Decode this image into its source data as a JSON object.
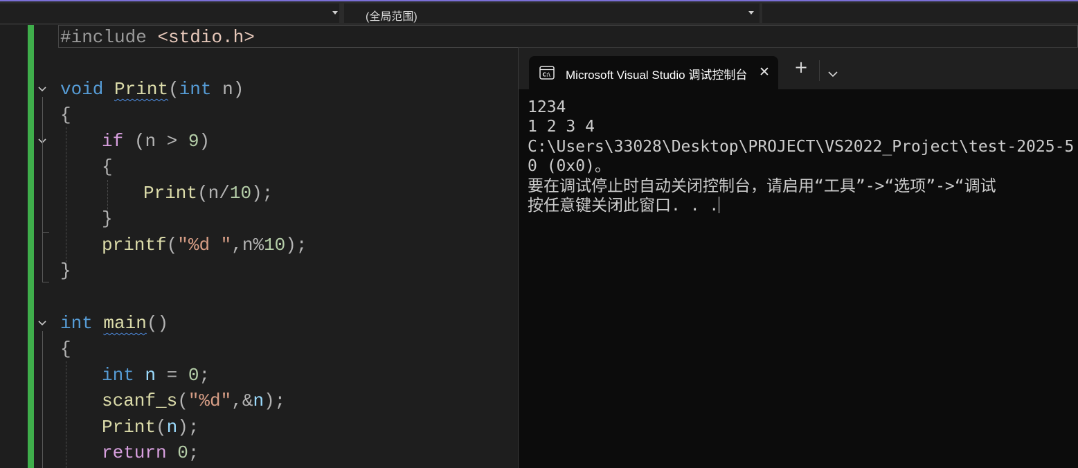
{
  "navbar": {
    "scope_dropdown": "(全局范围)"
  },
  "editor": {
    "include_line": "#include <stdio.h>",
    "tokens": {
      "include": "#include",
      "header": "<stdio.h>",
      "void": "void",
      "int": "int",
      "if": "if",
      "return": "return",
      "print": "Print",
      "printf": "printf",
      "scanf_s": "scanf_s",
      "main": "main",
      "n": "n",
      "nine": "9",
      "ten": "10",
      "zero": "0",
      "fmt1": "\"%d \"",
      "fmt2": "\"%d\""
    }
  },
  "console": {
    "tab_title": "Microsoft Visual Studio 调试控制台",
    "plus_label": "+",
    "close_label": "✕",
    "lines": [
      "1234",
      "1 2 3 4",
      "C:\\Users\\33028\\Desktop\\PROJECT\\VS2022_Project\\test-2025-5",
      "0 (0x0)。",
      "要在调试停止时自动关闭控制台，请启用“工具”->“选项”->“调试",
      "按任意键关闭此窗口. . ."
    ]
  },
  "colors": {
    "accent_top": "#7a6fd6",
    "change_bar": "#3fae4b",
    "keyword": "#569cd6",
    "function": "#dcdcaa",
    "string": "#d69d85"
  }
}
